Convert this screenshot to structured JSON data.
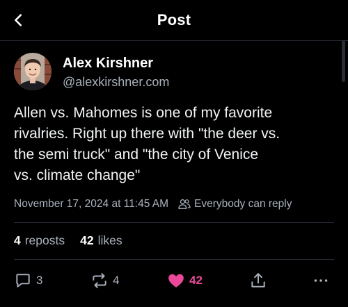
{
  "header": {
    "title": "Post",
    "back_icon": "chevron-left-icon"
  },
  "author": {
    "name": "Alex Kirshner",
    "handle": "@alexkirshner.com"
  },
  "post": {
    "text_lines": [
      "Allen vs. Mahomes is one of my favorite",
      "rivalries. Right up there with \"the deer vs.",
      "the semi truck\" and \"the city of Venice",
      "vs. climate change\""
    ],
    "timestamp": "November 17, 2024 at 11:45 AM",
    "reply_setting": "Everybody can reply",
    "reply_setting_icon": "people-icon"
  },
  "stats": {
    "reposts_count": "4",
    "reposts_label": "reposts",
    "likes_count": "42",
    "likes_label": "likes"
  },
  "actions": {
    "replies": "3",
    "reposts": "4",
    "likes": "42",
    "like_color": "#ec4899"
  },
  "colors": {
    "background": "#000000",
    "text_primary": "#ffffff",
    "text_secondary": "#a8b0bb",
    "divider": "#262b33",
    "like_accent": "#ec4899"
  }
}
